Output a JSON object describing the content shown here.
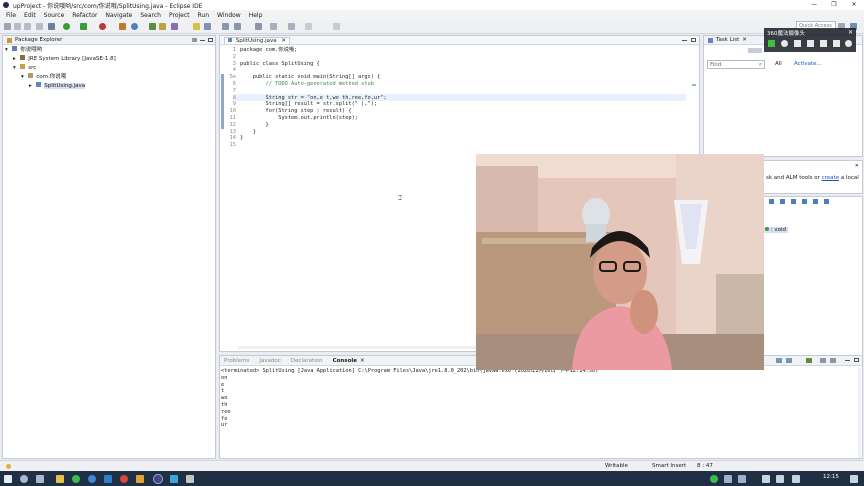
{
  "window": {
    "title": "upProject - 你说哦哟/src/com/你说哦/SplitUsing.java - Eclipse IDE",
    "controls": [
      "—",
      "❐",
      "✕"
    ]
  },
  "menu": [
    "File",
    "Edit",
    "Source",
    "Refactor",
    "Navigate",
    "Search",
    "Project",
    "Run",
    "Window",
    "Help"
  ],
  "toolbar": {
    "quick_access": "Quick Access"
  },
  "package_explorer": {
    "title": "Package Explorer",
    "tree": [
      {
        "label": "你说哦哟",
        "indent": 0,
        "arrow": "▾"
      },
      {
        "label": "JRE System Library [JavaSE-1.8]",
        "indent": 1,
        "arrow": "▸"
      },
      {
        "label": "src",
        "indent": 1,
        "arrow": "▾"
      },
      {
        "label": "com.你说哦",
        "indent": 2,
        "arrow": "▾"
      },
      {
        "label": "SplitUsing.java",
        "indent": 3,
        "arrow": "▸"
      }
    ]
  },
  "editor": {
    "tab": "SplitUsing.java",
    "lines": [
      {
        "n": "1",
        "text": "package com.你说哦;"
      },
      {
        "n": "2",
        "text": ""
      },
      {
        "n": "3",
        "text": "public class SplitUsing {"
      },
      {
        "n": "4",
        "text": ""
      },
      {
        "n": "5⊖",
        "text": "    public static void main(String[] args) {"
      },
      {
        "n": "6",
        "text": "        // TODO Auto-generated method stub"
      },
      {
        "n": "7",
        "text": ""
      },
      {
        "n": "8",
        "text": "        String str = \"on,e t,wo th,ree,fo,ur\";"
      },
      {
        "n": "9",
        "text": "        String[] result = str.split(\" |,\");"
      },
      {
        "n": "10",
        "text": "        for(String step : result) {"
      },
      {
        "n": "11",
        "text": "            System.out.println(step);"
      },
      {
        "n": "12",
        "text": "        }"
      },
      {
        "n": "13",
        "text": "    }"
      },
      {
        "n": "14",
        "text": "}"
      },
      {
        "n": "15",
        "text": ""
      }
    ]
  },
  "task_list": {
    "title": "Task List",
    "find_placeholder": "Find",
    "all_label": "All",
    "activate_label": "Activate..."
  },
  "right_fragments": {
    "text": "sk and ALM tools or",
    "link": "create",
    "text2": "a local",
    "outline_item": ": void"
  },
  "bottom_tabs": [
    "Problems",
    "Javadoc",
    "Declaration",
    "Console"
  ],
  "console": {
    "header": "<terminated> SplitUsing [Java Application] C:\\Program Files\\Java\\jre1.8.0_202\\bin\\javaw.exe (2020年2月16日 下午12:14:56)",
    "lines": [
      "on",
      "e",
      "t",
      "wo",
      "th",
      "ree",
      "fo",
      "ur"
    ]
  },
  "status": {
    "writable": "Writable",
    "insert": "Smart Insert",
    "position": "8 : 47"
  },
  "video_overlay": {
    "title": "360魔法摄像头"
  },
  "taskbar": {
    "time": "12:15"
  }
}
